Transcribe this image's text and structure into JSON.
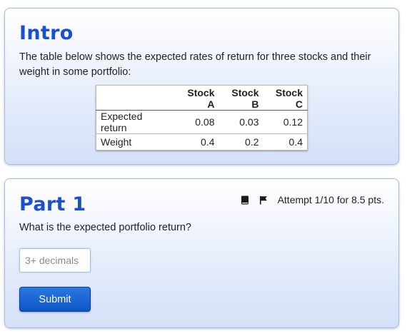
{
  "intro": {
    "title": "Intro",
    "text": "The table below shows the expected rates of return for three stocks and their weight in some portfolio:",
    "table": {
      "columns": [
        "",
        "Stock A",
        "Stock B",
        "Stock C"
      ],
      "rows": [
        {
          "label": "Expected return",
          "values": [
            "0.08",
            "0.03",
            "0.12"
          ]
        },
        {
          "label": "Weight",
          "values": [
            "0.4",
            "0.2",
            "0.4"
          ]
        }
      ]
    }
  },
  "part1": {
    "title": "Part 1",
    "attempt_text": "Attempt 1/10 for 8.5 pts.",
    "question": "What is the expected portfolio return?",
    "input": {
      "value": "",
      "placeholder": "3+ decimals"
    },
    "submit_label": "Submit"
  },
  "icons": {
    "book": "book-icon",
    "flag": "flag-icon"
  },
  "colors": {
    "title": "#1a4fd0",
    "submit": "#0d57c7"
  }
}
